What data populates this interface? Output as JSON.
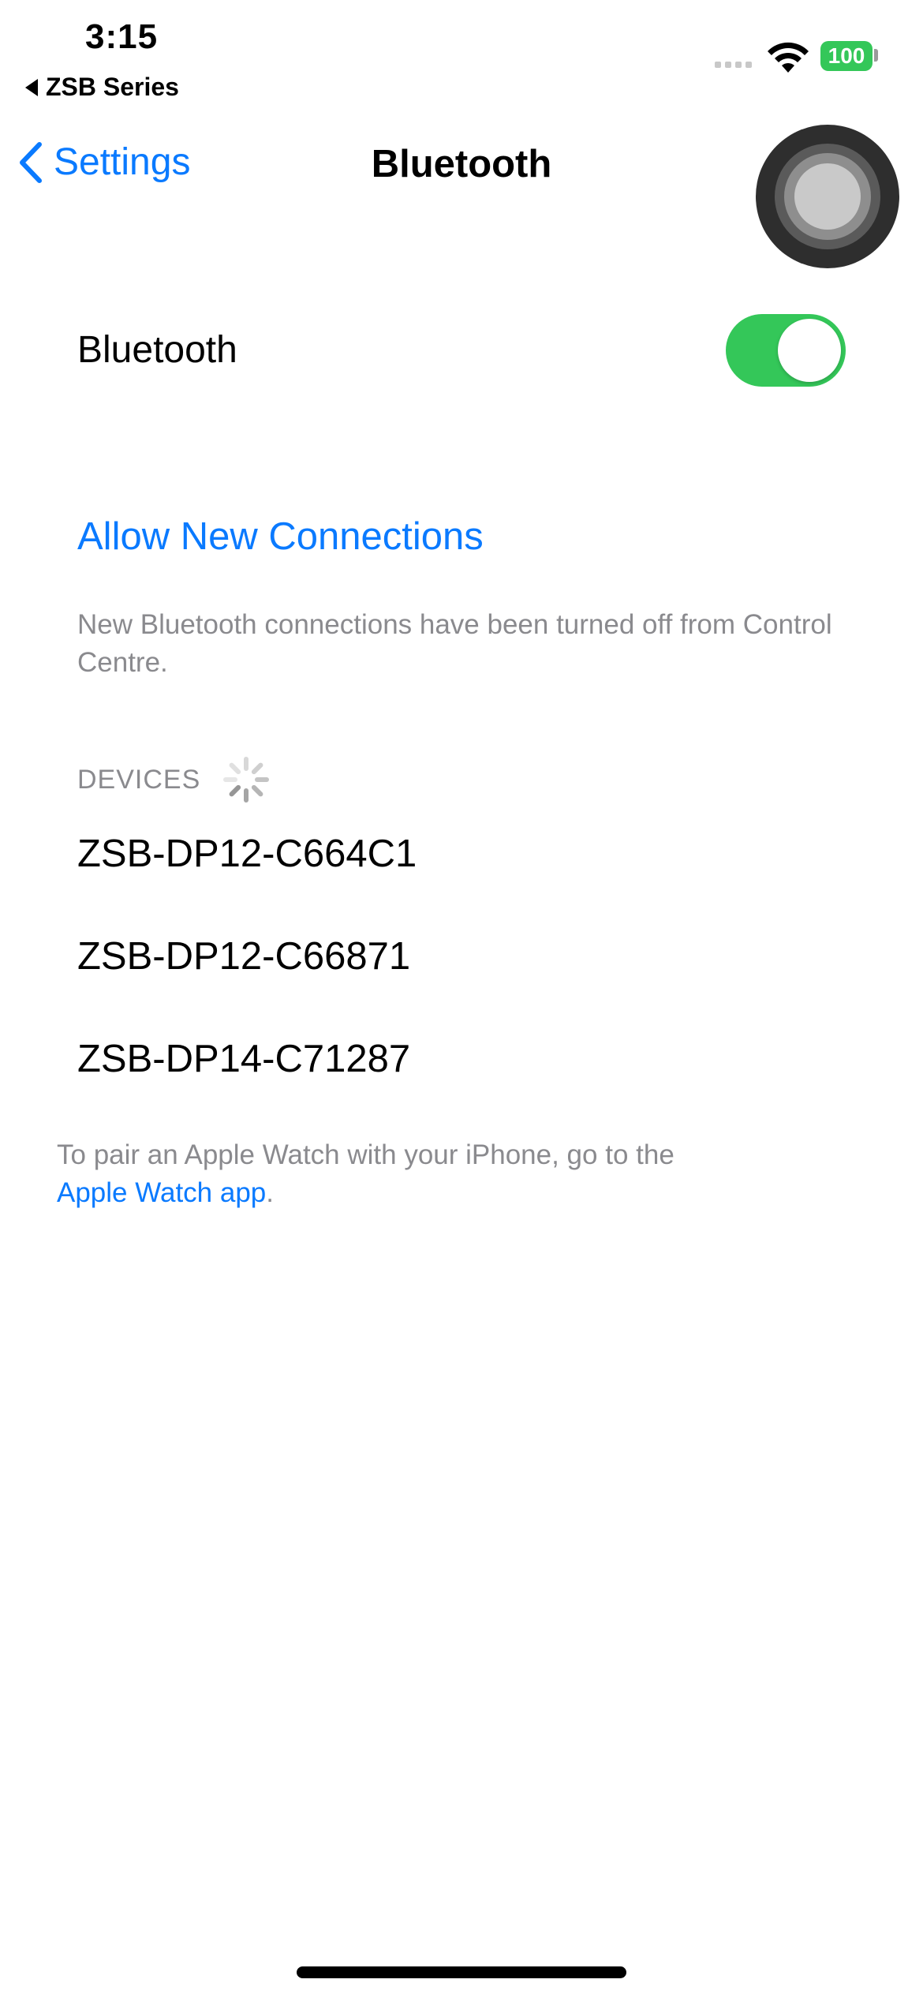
{
  "status_bar": {
    "time": "3:15",
    "back_app_label": "ZSB Series",
    "battery_level": "100",
    "icons": [
      "cellular-signal-icon",
      "wifi-icon",
      "battery-icon"
    ]
  },
  "nav": {
    "back_label": "Settings",
    "title": "Bluetooth"
  },
  "bluetooth": {
    "label": "Bluetooth",
    "enabled": true
  },
  "allow_new_connections_label": "Allow New Connections",
  "allow_footnote": "New Bluetooth connections have been turned off from Control Centre.",
  "devices": {
    "header": "DEVICES",
    "items": [
      {
        "name": "ZSB-DP12-C664C1"
      },
      {
        "name": "ZSB-DP12-C66871"
      },
      {
        "name": "ZSB-DP14-C71287"
      }
    ]
  },
  "watch_note": {
    "text": "To pair an Apple Watch with your iPhone, go to the",
    "link": "Apple Watch app",
    "suffix": "."
  },
  "colors": {
    "accent": "#0a7aff",
    "toggle_on": "#34c759",
    "secondary_text": "#8a8a8e"
  }
}
